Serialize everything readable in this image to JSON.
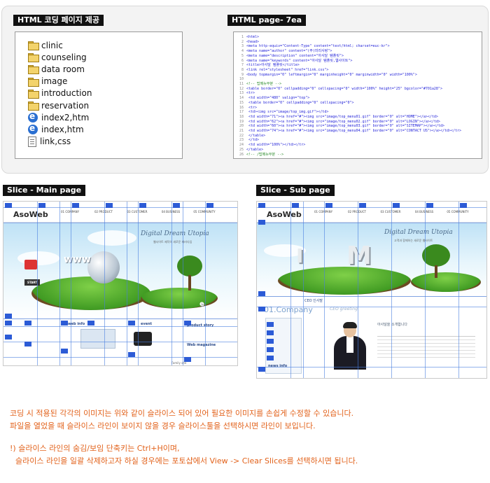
{
  "top": {
    "files_tag": "HTML 코딩 페이지 제공",
    "code_tag": "HTML page- 7ea",
    "files": [
      {
        "icon": "folder-icon",
        "name": "clinic"
      },
      {
        "icon": "folder-icon",
        "name": "counseling"
      },
      {
        "icon": "folder-icon",
        "name": "data room"
      },
      {
        "icon": "folder-icon",
        "name": "image"
      },
      {
        "icon": "folder-icon",
        "name": "introduction"
      },
      {
        "icon": "folder-icon",
        "name": "reservation"
      },
      {
        "icon": "html-file-icon",
        "name": "index2,htm"
      },
      {
        "icon": "html-file-icon",
        "name": "index,htm"
      },
      {
        "icon": "css-file-icon",
        "name": "link,css"
      }
    ],
    "code_lines": [
      {
        "n": "1",
        "t": "<html>"
      },
      {
        "n": "2",
        "t": "<head>"
      },
      {
        "n": "3",
        "t": "<meta http-equiv=\"Content-Type\" content=\"text/html; charset=euc-kr\">"
      },
      {
        "n": "4",
        "t": "<meta name=\"author\" content=\"(주)미리사랑\">"
      },
      {
        "n": "5",
        "t": "<meta name=\"description\" content=\"아사달 템플릿\">"
      },
      {
        "n": "6",
        "t": "<meta name=\"keywords\" content=\"아사달 템플릿,웹사이트\">"
      },
      {
        "n": "7",
        "t": "<title>아사달 템플릿</title>"
      },
      {
        "n": "8",
        "t": "<link rel=\"stylesheet\" href=\"link.css\">"
      },
      {
        "n": "9",
        "t": "<body topmargin=\"0\" leftmargin=\"0\" marginheight=\"0\" marginwidth=\"0\" width=\"100%\">"
      },
      {
        "n": "10",
        "t": ""
      },
      {
        "n": "11",
        "t": "<!-- 탑메뉴부분 -->"
      },
      {
        "n": "12",
        "t": "<table border=\"0\" cellpadding=\"0\" cellspacing=\"0\" width=\"100%\" height=\"25\" bgcolor=\"#701a28\">"
      },
      {
        "n": "13",
        "t": "<tr>"
      },
      {
        "n": "14",
        "t": "  <td width=\"480\" valign=\"top\">"
      },
      {
        "n": "15",
        "t": "    <table border=\"0\" cellpadding=\"0\" cellspacing=\"0\">"
      },
      {
        "n": "16",
        "t": "    <tr>"
      },
      {
        "n": "17",
        "t": "      <td><img src=\"image/top_img.gif\"></td>"
      },
      {
        "n": "18",
        "t": "      <td width=\"71\"><a href=\"#\"><img src=\"image/top_menu01.gif\" border=\"0\" alt=\"HOME\"></a></td>"
      },
      {
        "n": "19",
        "t": "      <td width=\"62\"><a href=\"#\"><img src=\"image/top_menu02.gif\" border=\"0\" alt=\"LOGIN\"></a></td>"
      },
      {
        "n": "20",
        "t": "      <td width=\"60\"><a href=\"#\"><img src=\"image/top_menu03.gif\" border=\"0\" alt=\"SITEMAP\"></a></td>"
      },
      {
        "n": "21",
        "t": "      <td width=\"74\"><a href=\"#\"><img src=\"image/top_menu04.gif\" border=\"0\" alt=\"CONTACT US\"></a></td></tr>"
      },
      {
        "n": "22",
        "t": "    </table>"
      },
      {
        "n": "23",
        "t": "  </td>"
      },
      {
        "n": "24",
        "t": "  <td width=\"100%\"></td></tr>"
      },
      {
        "n": "25",
        "t": "</table>"
      },
      {
        "n": "26",
        "t": "<!-- /탑메뉴부분 -->"
      }
    ]
  },
  "main_slice": {
    "tag": "Slice - Main page",
    "logo": "AsoWeb",
    "nav": [
      "01 COMPANY",
      "02 PRODUCT",
      "03 CUSTOMER",
      "04 BUSINESS",
      "05 COMMUNITY"
    ],
    "hero_title": "Digital Dream Utopia",
    "hero_sub": "웹사이트 제작의 새로운 패러다임",
    "www": "www",
    "start": "START",
    "boxes": [
      "web info",
      "event",
      "product story",
      "Web magazine"
    ],
    "family": "Family site"
  },
  "sub_slice": {
    "tag": "Slice - Sub page",
    "logo": "AsoWeb",
    "nav": [
      "01 COMPANY",
      "02 PRODUCT",
      "03 CUSTOMER",
      "04 BUSINESS",
      "05 COMMUNITY"
    ],
    "hero_title": "Digital Dream Utopia",
    "hero_sub": "고객과 함께하는 새로운 웹사이트",
    "letters": [
      "I",
      "M"
    ],
    "ceo_label": "CEO 인사말",
    "company": "01.Company",
    "greeting": "CEO greeting",
    "welcome": "아사달을 소개합니다",
    "menu_box": "news info"
  },
  "notes": {
    "line1": "코딩 시 적용된 각각의 이미지는 위와 같이 슬라이스 되어 있어 필요한 이미지를 손쉽게 수정할 수 있습니다.",
    "line2": "파일을 열었을 때 슬라이스 라인이 보이지 않을 경우 슬라이스툴을 선택하시면 라인이 보입니다.",
    "line3": "!) 슬라이스 라인의 숨김/보임 단축키는 Ctrl+H이며,",
    "line4": "슬라이스 라인을 일괄 삭제하고자 하실 경우에는 포토샵에서 View -> Clear Slices를 선택하시면 됩니다."
  }
}
